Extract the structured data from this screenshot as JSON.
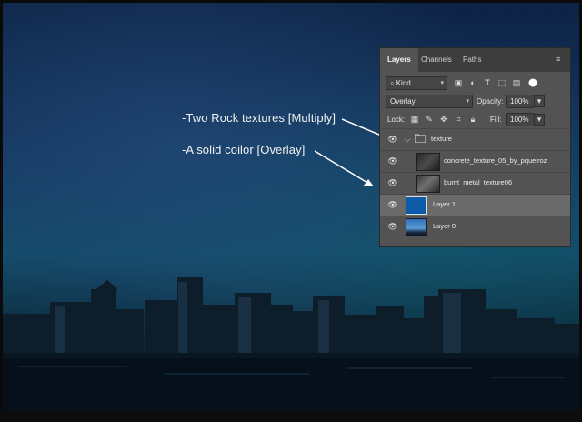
{
  "annotations": {
    "rock_textures": "-Two Rock textures [Multiply]",
    "solid_color": "-A solid coilor [Overlay]"
  },
  "panel": {
    "tabs": [
      {
        "label": "Layers",
        "active": true
      },
      {
        "label": "Channels",
        "active": false
      },
      {
        "label": "Paths",
        "active": false
      }
    ],
    "filter": {
      "selected": "Kind"
    },
    "blend_mode": "Overlay",
    "opacity_label": "Opacity:",
    "opacity_value": "100%",
    "lock_label": "Lock:",
    "fill_label": "Fill:",
    "fill_value": "100%",
    "group": {
      "name": "texture",
      "expanded": true
    },
    "layers": [
      {
        "name": "concrete_texture_05_by_pqueiroz",
        "selected": false,
        "thumb": "dark-concrete"
      },
      {
        "name": "burnt_metal_texture06",
        "selected": false,
        "thumb": "metal"
      },
      {
        "name": "Layer 1",
        "selected": true,
        "thumb": "solid-blue"
      },
      {
        "name": "Layer 0",
        "selected": false,
        "thumb": "city-photo"
      }
    ]
  },
  "colors": {
    "panel_bg": "#535353",
    "tab_bar_bg": "#3d3d3d",
    "selected_row": "#6a6a6a",
    "solid_fill": "#0d5ca8",
    "annotation_text": "#f2f2f2"
  }
}
